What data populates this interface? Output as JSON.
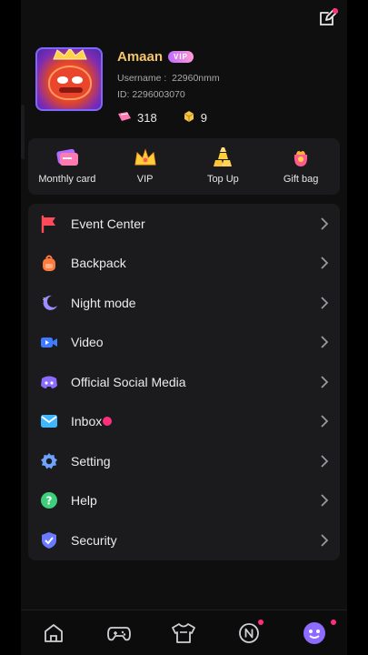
{
  "profile": {
    "name": "Amaan",
    "badge": "VIP",
    "username": "Username :  22960nmm",
    "id": "ID: 2296003070",
    "coupons": "318",
    "gold": "9"
  },
  "quick_actions": [
    {
      "label": "Monthly card",
      "icon": "monthly-card-icon"
    },
    {
      "label": "VIP",
      "icon": "crown-icon"
    },
    {
      "label": "Top Up",
      "icon": "gold-bars-icon"
    },
    {
      "label": "Gift bag",
      "icon": "gift-bag-icon"
    }
  ],
  "menu": [
    {
      "label": "Event Center",
      "icon": "flag-icon",
      "color": "#ff4a5a"
    },
    {
      "label": "Backpack",
      "icon": "backpack-icon",
      "color": "#ff7a3d"
    },
    {
      "label": "Night mode",
      "icon": "moon-icon",
      "color": "#9b8cff"
    },
    {
      "label": "Video",
      "icon": "video-camera-icon",
      "color": "#3f7bff"
    },
    {
      "label": "Official Social Media",
      "icon": "discord-icon",
      "color": "#8e6bff"
    },
    {
      "label": "Inbox",
      "icon": "mail-icon",
      "color": "#3fb7ff"
    },
    {
      "label": "Setting",
      "icon": "gear-icon",
      "color": "#6fa2ff"
    },
    {
      "label": "Help",
      "icon": "help-icon",
      "color": "#3ecf7a"
    },
    {
      "label": "Security",
      "icon": "shield-icon",
      "color": "#6a7bff"
    }
  ],
  "nav": [
    {
      "name": "home-icon"
    },
    {
      "name": "gamepad-icon"
    },
    {
      "name": "shirt-icon"
    },
    {
      "name": "notification-n-icon"
    },
    {
      "name": "profile-avatar-icon"
    }
  ],
  "colors": {
    "accent": "#8e6bff",
    "badge_dot": "#ff2f7d",
    "name": "#f5c66a"
  }
}
